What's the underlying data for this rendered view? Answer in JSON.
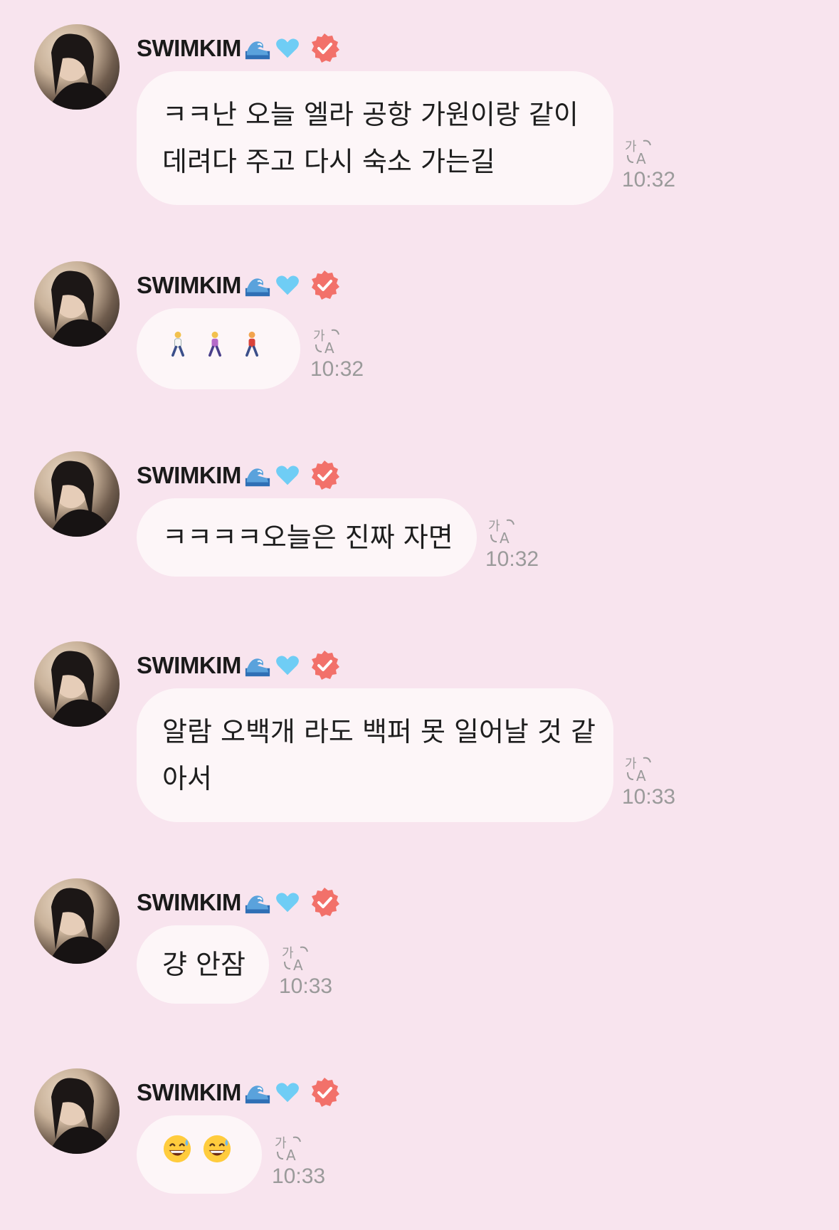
{
  "sender": {
    "name": "SWIMKIM",
    "name_emojis": [
      "wave-icon",
      "blue-heart-icon",
      "verified-badge-icon"
    ]
  },
  "colors": {
    "background": "#f8e4ee",
    "bubble": "#fdf6f8",
    "timestamp": "#9a9a9a",
    "verified": "#f2716a",
    "heart": "#6fcdf5"
  },
  "messages": [
    {
      "lines": [
        "ㅋㅋ난 오늘 엘라 공항 가원이랑 같이",
        "데려다 주고 다시 숙소 가는길"
      ],
      "time": "10:32"
    },
    {
      "emojis": [
        "person-walking-icon",
        "woman-walking-icon",
        "man-walking-icon"
      ],
      "time": "10:32"
    },
    {
      "lines": [
        "ㅋㅋㅋㅋ오늘은 진짜 자면"
      ],
      "time": "10:32"
    },
    {
      "lines": [
        "알람 오백개 라도 백퍼 못 일어날 것 같",
        "아서"
      ],
      "time": "10:33"
    },
    {
      "lines": [
        "걍 안잠"
      ],
      "time": "10:33"
    },
    {
      "emojis": [
        "grinning-sweat-icon",
        "grinning-sweat-icon"
      ],
      "time": "10:33"
    }
  ]
}
